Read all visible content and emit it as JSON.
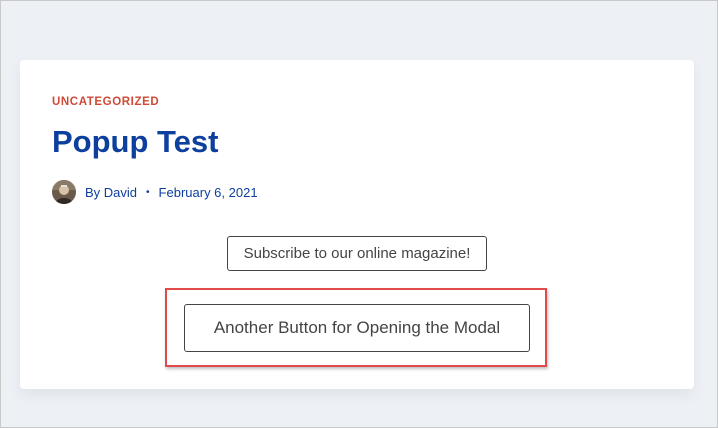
{
  "post": {
    "category": "UNCATEGORIZED",
    "title": "Popup Test",
    "author": "By David",
    "separator": "•",
    "date": "February 6, 2021"
  },
  "buttons": {
    "subscribe_label": "Subscribe to our online magazine!",
    "modal_label": "Another Button for Opening the Modal"
  },
  "colors": {
    "category": "#cf4a35",
    "title": "#0d3f9e",
    "highlight_border": "#e04a4a",
    "page_background": "#edf1f6"
  },
  "icons": {
    "avatar": "author-avatar-photo"
  }
}
